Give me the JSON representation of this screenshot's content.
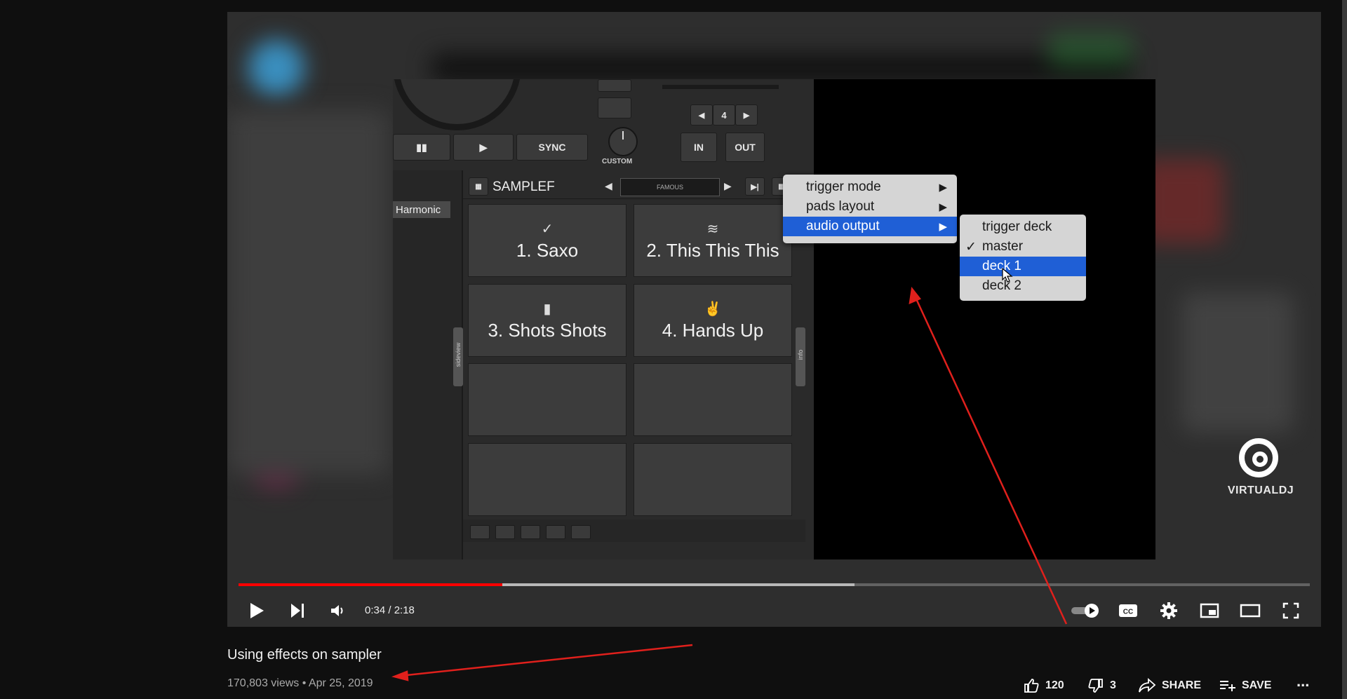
{
  "video": {
    "title": "Using effects on sampler",
    "views": "170,803 views",
    "date": "Apr 25, 2019",
    "meta_separator": "•"
  },
  "player": {
    "time": "0:34 / 2:18",
    "played_fraction": 0.246,
    "buffered_fraction": 0.575,
    "watermark": "VIRTUALDJ"
  },
  "actions": {
    "likes": "120",
    "dislikes": "3",
    "share": "SHARE",
    "save": "SAVE",
    "more": "..."
  },
  "software": {
    "buttons": {
      "cue": "▮▮",
      "play": "▶",
      "sync": "SYNC",
      "custom": "CUSTOM",
      "in": "IN",
      "out": "OUT",
      "loop_value": "4"
    },
    "sidebar_label": "Harmonic",
    "sampler_title": "SAMPLEF",
    "sampler_bank": "FAMOUS",
    "side_tabs": {
      "left": "sideview",
      "right": "info"
    },
    "pads": [
      {
        "icon": "✓",
        "label": "1. Saxo"
      },
      {
        "icon": "≋",
        "label": "2. This This This"
      },
      {
        "icon": "▮",
        "label": "3. Shots Shots"
      },
      {
        "icon": "✌",
        "label": "4. Hands Up"
      },
      {
        "icon": "",
        "label": ""
      },
      {
        "icon": "",
        "label": ""
      },
      {
        "icon": "",
        "label": ""
      },
      {
        "icon": "",
        "label": ""
      }
    ]
  },
  "context_menu": {
    "items": [
      {
        "label": "trigger mode",
        "arrow": "▶"
      },
      {
        "label": "pads layout",
        "arrow": "▶"
      },
      {
        "label": "audio output",
        "arrow": "▶"
      }
    ],
    "submenu": [
      {
        "label": "trigger deck",
        "check": ""
      },
      {
        "label": "master",
        "check": "✓"
      },
      {
        "label": "deck 1",
        "check": ""
      },
      {
        "label": "deck 2",
        "check": ""
      }
    ]
  },
  "colors": {
    "progress_played": "#ff0000",
    "menu_highlight": "#1f5fd6",
    "annotation_arrow": "#e0201c"
  }
}
